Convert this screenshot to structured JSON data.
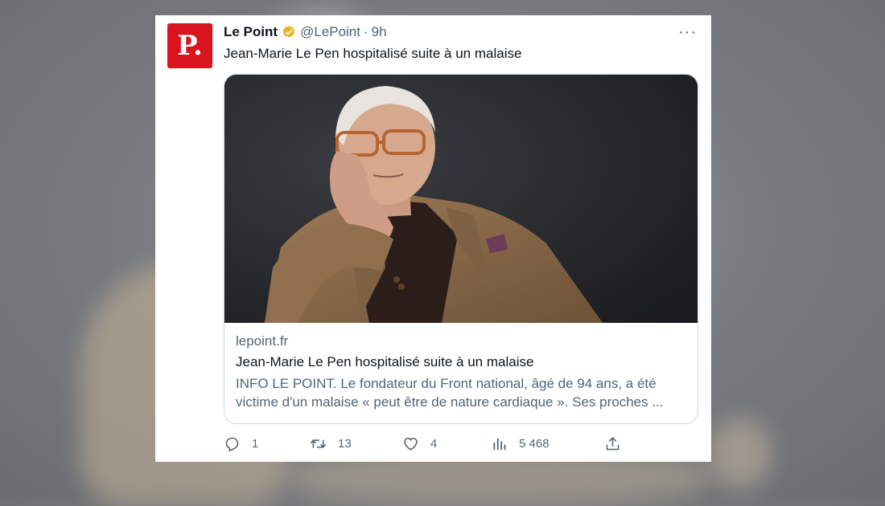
{
  "tweet": {
    "author_name": "Le Point",
    "avatar_letter": "P",
    "handle": "@LePoint",
    "separator": "·",
    "time": "9h",
    "more_label": "···",
    "text": "Jean-Marie Le Pen hospitalisé suite à un malaise",
    "verified_color": "#e2b719",
    "brand_color": "#d9141e"
  },
  "link_card": {
    "domain": "lepoint.fr",
    "title": "Jean-Marie Le Pen hospitalisé suite à un malaise",
    "description": "INFO LE POINT. Le fondateur du Front national, âgé de 94 ans, a été victime d'un malaise « peut être de nature cardiaque ». Ses proches ..."
  },
  "actions": {
    "replies": "1",
    "retweets": "13",
    "likes": "4",
    "views": "5 468"
  }
}
